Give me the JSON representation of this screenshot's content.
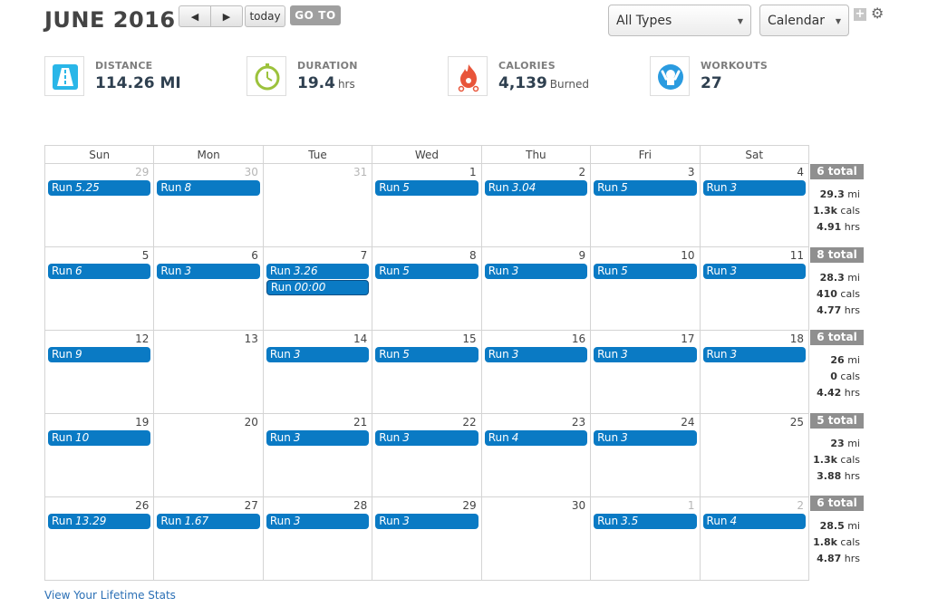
{
  "header": {
    "title": "JUNE 2016",
    "prev_glyph": "◀",
    "next_glyph": "▶",
    "today_label": "today",
    "goto_label": "GO TO",
    "type_select": "All Types",
    "view_select": "Calendar",
    "plus_glyph": "+",
    "gear_glyph": "⚙"
  },
  "stats": {
    "distance": {
      "label": "DISTANCE",
      "value": "114.26 MI",
      "unit": ""
    },
    "duration": {
      "label": "DURATION",
      "value": "19.4",
      "unit": "hrs"
    },
    "calories": {
      "label": "CALORIES",
      "value": "4,139",
      "unit": "Burned"
    },
    "workouts": {
      "label": "WORKOUTS",
      "value": "27",
      "unit": ""
    }
  },
  "weekdays": [
    "Sun",
    "Mon",
    "Tue",
    "Wed",
    "Thu",
    "Fri",
    "Sat"
  ],
  "weeks": [
    [
      {
        "day": "29",
        "other": true,
        "events": [
          {
            "t": "Run",
            "d": "5.25"
          }
        ]
      },
      {
        "day": "30",
        "other": true,
        "events": [
          {
            "t": "Run",
            "d": "8"
          }
        ]
      },
      {
        "day": "31",
        "other": true,
        "events": []
      },
      {
        "day": "1",
        "events": [
          {
            "t": "Run",
            "d": "5"
          }
        ]
      },
      {
        "day": "2",
        "events": [
          {
            "t": "Run",
            "d": "3.04"
          }
        ]
      },
      {
        "day": "3",
        "events": [
          {
            "t": "Run",
            "d": "5"
          }
        ]
      },
      {
        "day": "4",
        "events": [
          {
            "t": "Run",
            "d": "3"
          }
        ]
      }
    ],
    [
      {
        "day": "5",
        "events": [
          {
            "t": "Run",
            "d": "6"
          }
        ]
      },
      {
        "day": "6",
        "events": [
          {
            "t": "Run",
            "d": "3"
          }
        ]
      },
      {
        "day": "7",
        "events": [
          {
            "t": "Run",
            "d": "3.26"
          },
          {
            "t": "Run",
            "d": "00:00"
          }
        ]
      },
      {
        "day": "8",
        "events": [
          {
            "t": "Run",
            "d": "5"
          }
        ]
      },
      {
        "day": "9",
        "events": [
          {
            "t": "Run",
            "d": "3"
          }
        ]
      },
      {
        "day": "10",
        "events": [
          {
            "t": "Run",
            "d": "5"
          }
        ]
      },
      {
        "day": "11",
        "events": [
          {
            "t": "Run",
            "d": "3"
          }
        ]
      }
    ],
    [
      {
        "day": "12",
        "events": [
          {
            "t": "Run",
            "d": "9"
          }
        ]
      },
      {
        "day": "13",
        "events": []
      },
      {
        "day": "14",
        "events": [
          {
            "t": "Run",
            "d": "3"
          }
        ]
      },
      {
        "day": "15",
        "events": [
          {
            "t": "Run",
            "d": "5"
          }
        ]
      },
      {
        "day": "16",
        "events": [
          {
            "t": "Run",
            "d": "3"
          }
        ]
      },
      {
        "day": "17",
        "events": [
          {
            "t": "Run",
            "d": "3"
          }
        ]
      },
      {
        "day": "18",
        "events": [
          {
            "t": "Run",
            "d": "3"
          }
        ]
      }
    ],
    [
      {
        "day": "19",
        "events": [
          {
            "t": "Run",
            "d": "10"
          }
        ]
      },
      {
        "day": "20",
        "events": []
      },
      {
        "day": "21",
        "events": [
          {
            "t": "Run",
            "d": "3"
          }
        ]
      },
      {
        "day": "22",
        "events": [
          {
            "t": "Run",
            "d": "3"
          }
        ]
      },
      {
        "day": "23",
        "events": [
          {
            "t": "Run",
            "d": "4"
          }
        ]
      },
      {
        "day": "24",
        "events": [
          {
            "t": "Run",
            "d": "3"
          }
        ]
      },
      {
        "day": "25",
        "events": []
      }
    ],
    [
      {
        "day": "26",
        "events": [
          {
            "t": "Run",
            "d": "13.29"
          }
        ]
      },
      {
        "day": "27",
        "events": [
          {
            "t": "Run",
            "d": "1.67"
          }
        ]
      },
      {
        "day": "28",
        "events": [
          {
            "t": "Run",
            "d": "3"
          }
        ]
      },
      {
        "day": "29",
        "events": [
          {
            "t": "Run",
            "d": "3"
          }
        ]
      },
      {
        "day": "30",
        "events": []
      },
      {
        "day": "1",
        "other": true,
        "events": [
          {
            "t": "Run",
            "d": "3.5"
          }
        ]
      },
      {
        "day": "2",
        "other": true,
        "events": [
          {
            "t": "Run",
            "d": "4"
          }
        ]
      }
    ]
  ],
  "summaries": [
    {
      "total": "6 total",
      "mi": "29.3",
      "mi_unit": "mi",
      "cals": "1.3k",
      "cals_unit": "cals",
      "hrs": "4.91",
      "hrs_unit": "hrs"
    },
    {
      "total": "8 total",
      "mi": "28.3",
      "mi_unit": "mi",
      "cals": "410",
      "cals_unit": "cals",
      "hrs": "4.77",
      "hrs_unit": "hrs"
    },
    {
      "total": "6 total",
      "mi": "26",
      "mi_unit": "mi",
      "cals": "0",
      "cals_unit": "cals",
      "hrs": "4.42",
      "hrs_unit": "hrs"
    },
    {
      "total": "5 total",
      "mi": "23",
      "mi_unit": "mi",
      "cals": "1.3k",
      "cals_unit": "cals",
      "hrs": "3.88",
      "hrs_unit": "hrs"
    },
    {
      "total": "6 total",
      "mi": "28.5",
      "mi_unit": "mi",
      "cals": "1.8k",
      "cals_unit": "cals",
      "hrs": "4.87",
      "hrs_unit": "hrs"
    }
  ],
  "footer": {
    "lifetime_link": "View Your Lifetime Stats"
  },
  "colors": {
    "event": "#0a7ac4",
    "total_badge": "#8f8f8f",
    "link": "#2a6fb5"
  }
}
